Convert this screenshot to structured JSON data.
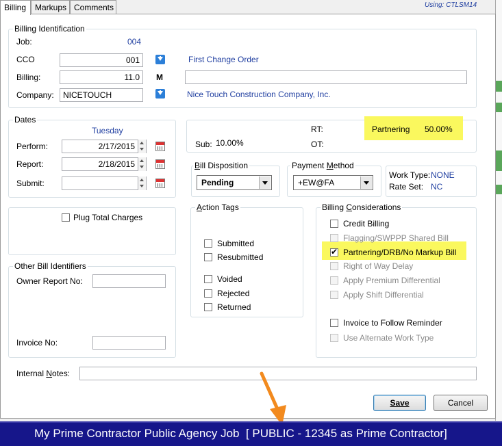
{
  "tabs": [
    "Billing",
    "Markups",
    "Comments"
  ],
  "using": "Using: CTLSM14",
  "billing_identification": {
    "title": "Billing Identification",
    "job_label": "Job:",
    "job_value": "004",
    "cco_label": "CCO",
    "cco_value": "001",
    "cco_description": "First Change Order",
    "billing_label": "Billing:",
    "billing_value": "11.0",
    "billing_code": "M",
    "billing_description": "",
    "company_label": "Company:",
    "company_value": "NICETOUCH",
    "company_name": "Nice Touch Construction Company, Inc."
  },
  "dates": {
    "title": "Dates",
    "day_name": "Tuesday",
    "perform_label": "Perform:",
    "perform_value": "2/17/2015",
    "report_label": "Report:",
    "report_value": "2/18/2015",
    "submit_label": "Submit:",
    "submit_value": ""
  },
  "rates": {
    "rt_label": "RT:",
    "ot_label": "OT:",
    "sub_label": "Sub:",
    "sub_value": "10.00%",
    "partnering_label": "Partnering",
    "partnering_value": "50.00%"
  },
  "bill_disposition": {
    "title": "Bill Disposition",
    "value": "Pending"
  },
  "payment_method": {
    "title": "Payment Method",
    "value": "+EW@FA"
  },
  "work_info": {
    "work_type_label": "Work Type:",
    "work_type_value": "NONE",
    "rate_set_label": "Rate Set:",
    "rate_set_value": "NC"
  },
  "plug_total_charges": {
    "label": "Plug Total Charges",
    "checked": false
  },
  "other_bill_identifiers": {
    "title": "Other Bill Identifiers",
    "owner_report_label": "Owner Report No:",
    "owner_report_value": "",
    "invoice_label": "Invoice No:",
    "invoice_value": ""
  },
  "action_tags": {
    "title": "Action Tags",
    "items": [
      {
        "label": "Submitted",
        "checked": false
      },
      {
        "label": "Resubmitted",
        "checked": false
      },
      {
        "label": "Voided",
        "checked": false
      },
      {
        "label": "Rejected",
        "checked": false
      },
      {
        "label": "Returned",
        "checked": false
      }
    ]
  },
  "billing_considerations": {
    "title": "Billing Considerations",
    "items": [
      {
        "label": "Credit Billing",
        "checked": false,
        "enabled": true
      },
      {
        "label": "Flagging/SWPPP Shared Bill",
        "checked": false,
        "enabled": false
      },
      {
        "label": "Partnering/DRB/No Markup Bill",
        "checked": true,
        "enabled": true
      },
      {
        "label": "Right of Way Delay",
        "checked": false,
        "enabled": false
      },
      {
        "label": "Apply Premium Differential",
        "checked": false,
        "enabled": false
      },
      {
        "label": "Apply Shift Differential",
        "checked": false,
        "enabled": false
      },
      {
        "label": "Invoice to Follow Reminder",
        "checked": false,
        "enabled": true
      },
      {
        "label": "Use Alternate Work Type",
        "checked": false,
        "enabled": false
      }
    ]
  },
  "internal_notes": {
    "label": "Internal Notes:",
    "value": ""
  },
  "save_button": "Save",
  "cancel_button": "Cancel",
  "status_bar": "My Prime Contractor Public Agency Job  [ PUBLIC - 12345 as Prime Contractor]",
  "colors": {
    "highlight": "#faf85e",
    "status_bar": "#16168a",
    "arrow": "#f28a1e",
    "link_blue": "#1f3ea0"
  }
}
